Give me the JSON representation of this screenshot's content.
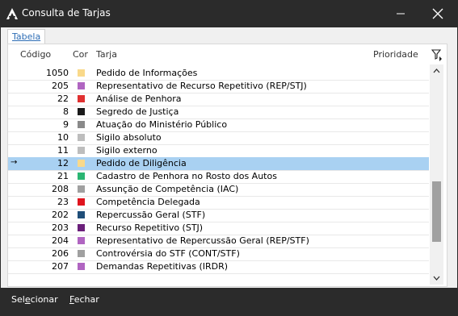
{
  "window": {
    "title": "Consulta de Tarjas"
  },
  "tabs": [
    {
      "label": "Tabela"
    }
  ],
  "grid": {
    "columns": {
      "codigo": "Código",
      "cor": "Cor",
      "tarja": "Tarja",
      "prioridade": "Prioridade"
    },
    "rows": [
      {
        "codigo": "1050",
        "color": "#f9d98a",
        "tarja": "Pedido de Informações"
      },
      {
        "codigo": "205",
        "color": "#b065c1",
        "tarja": "Representativo de Recurso Repetitivo (REP/STJ)"
      },
      {
        "codigo": "22",
        "color": "#e03030",
        "tarja": "Análise de Penhora"
      },
      {
        "codigo": "8",
        "color": "#1a1a1a",
        "tarja": "Segredo de Justiça"
      },
      {
        "codigo": "9",
        "color": "#8a8a8a",
        "tarja": "Atuação do Ministério Público"
      },
      {
        "codigo": "10",
        "color": "#bdbdbd",
        "tarja": "Sigilo absoluto"
      },
      {
        "codigo": "11",
        "color": "#bdbdbd",
        "tarja": "Sigilo externo"
      },
      {
        "codigo": "12",
        "color": "#f9d98a",
        "tarja": "Pedido de Diligência",
        "selected": true,
        "indicator": "→"
      },
      {
        "codigo": "21",
        "color": "#2bb673",
        "tarja": "Cadastro de Penhora no Rosto dos Autos"
      },
      {
        "codigo": "208",
        "color": "#a0a0a0",
        "tarja": "Assunção de Competência (IAC)"
      },
      {
        "codigo": "23",
        "color": "#e0141e",
        "tarja": "Competência Delegada"
      },
      {
        "codigo": "202",
        "color": "#1f4e79",
        "tarja": "Repercussão Geral (STF)"
      },
      {
        "codigo": "203",
        "color": "#6a1f7a",
        "tarja": "Recurso Repetitivo (STJ)"
      },
      {
        "codigo": "204",
        "color": "#b065c1",
        "tarja": "Representativo de Repercussão Geral (REP/STF)"
      },
      {
        "codigo": "206",
        "color": "#a0a0a0",
        "tarja": "Controvérsia do STF (CONT/STF)"
      },
      {
        "codigo": "207",
        "color": "#b065c1",
        "tarja": "Demandas Repetitivas (IRDR)"
      }
    ]
  },
  "footer": {
    "selecionar_pre": "Sel",
    "selecionar_u": "e",
    "selecionar_post": "cionar",
    "fechar_u": "F",
    "fechar_post": "echar"
  }
}
